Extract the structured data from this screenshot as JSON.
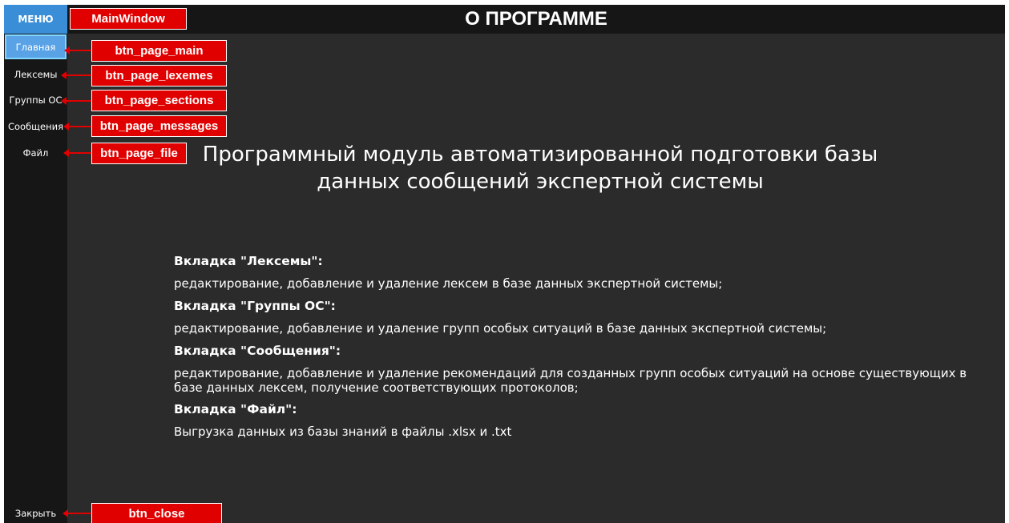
{
  "window": {
    "menu_label": "МЕНЮ",
    "title": "О ПРОГРАММЕ"
  },
  "nav": {
    "main": "Главная",
    "lexemes": "Лексемы",
    "sections": "Группы ОС",
    "messages": "Сообщения",
    "file": "Файл",
    "close": "Закрыть"
  },
  "content": {
    "heading": "Программный модуль автоматизированной подготовки базы данных сообщений экспертной системы",
    "sections": [
      {
        "title": "Вкладка \"Лексемы\":",
        "description": "редактирование, добавление и удаление лексем в базе данных экспертной системы;"
      },
      {
        "title": "Вкладка \"Группы ОС\":",
        "description": "редактирование, добавление и удаление групп особых ситуаций в базе данных экспертной системы;"
      },
      {
        "title": "Вкладка \"Сообщения\":",
        "description": "редактирование, добавление и удаление рекомендаций для созданных групп особых ситуаций на основе существующих в базе данных лексем, получение соответствующих протоколов;"
      },
      {
        "title": "Вкладка \"Файл\":",
        "description": "Выгрузка данных из базы знаний в файлы .xlsx и .txt"
      }
    ]
  },
  "annotations": {
    "main_window": "MainWindow",
    "btn_page_main": "btn_page_main",
    "btn_page_lexemes": "btn_page_lexemes",
    "btn_page_sections": "btn_page_sections",
    "btn_page_messages": "btn_page_messages",
    "btn_page_file": "btn_page_file",
    "btn_close": "btn_close"
  },
  "colors": {
    "accent": "#3a8ed8",
    "active_button": "#5aa2e6",
    "annotation": "#e00000",
    "background": "#2b2b2b",
    "sidebar": "#161616"
  }
}
